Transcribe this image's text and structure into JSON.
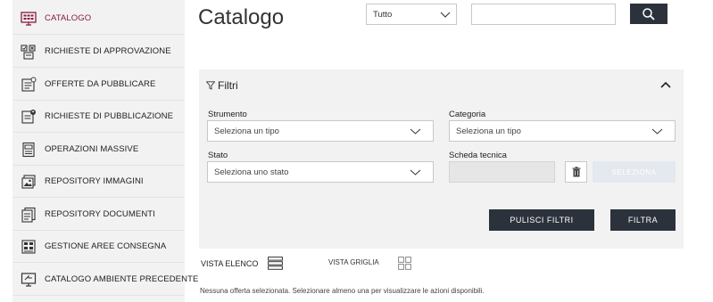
{
  "sidebar": {
    "items": [
      {
        "label": "CATALOGO",
        "icon": "catalog-grid-icon",
        "active": true
      },
      {
        "label": "RICHIESTE DI APPROVAZIONE",
        "icon": "approval-checklist-icon"
      },
      {
        "label": "OFFERTE DA PUBBLICARE",
        "icon": "offer-to-publish-icon"
      },
      {
        "label": "RICHIESTE DI PUBBLICAZIONE",
        "icon": "publish-request-icon"
      },
      {
        "label": "OPERAZIONI MASSIVE",
        "icon": "bulk-operations-icon"
      },
      {
        "label": "REPOSITORY IMMAGINI",
        "icon": "image-repository-icon"
      },
      {
        "label": "REPOSITORY DOCUMENTI",
        "icon": "document-repository-icon"
      },
      {
        "label": "GESTIONE AREE CONSEGNA",
        "icon": "delivery-area-icon"
      },
      {
        "label": "CATALOGO AMBIENTE PRECEDENTE",
        "icon": "previous-environment-monitor-icon"
      }
    ],
    "active_color": "#8a1a3c"
  },
  "header": {
    "title": "Catalogo",
    "scope_select": {
      "value": "Tutto"
    },
    "search": {
      "value": "",
      "placeholder": ""
    },
    "search_button_icon": "search-icon"
  },
  "filters": {
    "title": "Filtri",
    "strumento": {
      "label": "Strumento",
      "placeholder": "Seleziona un tipo"
    },
    "categoria": {
      "label": "Categoria",
      "placeholder": "Seleziona un tipo"
    },
    "stato": {
      "label": "Stato",
      "placeholder": "Seleziona uno stato"
    },
    "scheda_tecnica": {
      "label": "Scheda tecnica",
      "value": ""
    },
    "seleziona_label": "SELEZIONA",
    "clear_label": "PULISCI FILTRI",
    "apply_label": "FILTRA"
  },
  "view": {
    "list_label": "VISTA ELENCO",
    "grid_label": "VISTA GRIGLIA"
  },
  "status_message": "Nessuna offerta selezionata. Selezionare almeno una per visualizzare le azioni disponibili.",
  "colors": {
    "dark_button": "#2b323b",
    "panel_bg": "#f2f2f2",
    "accent": "#8a1a3c"
  }
}
